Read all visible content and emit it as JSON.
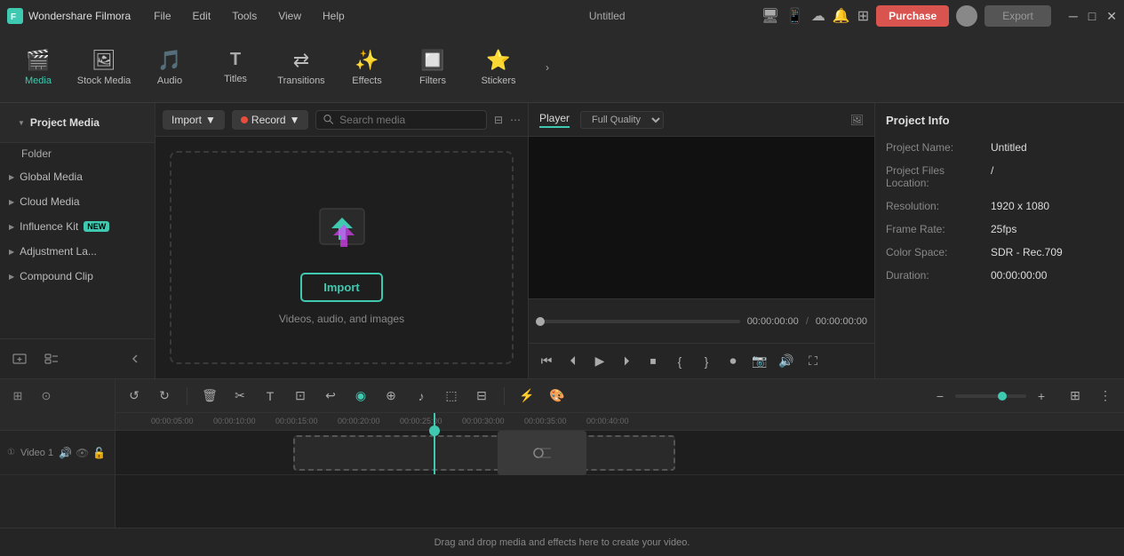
{
  "titlebar": {
    "app_name": "Wondershare Filmora",
    "menu_items": [
      "File",
      "Edit",
      "Tools",
      "View",
      "Help"
    ],
    "project_name": "Untitled",
    "purchase_label": "Purchase",
    "export_label": "Export"
  },
  "toolbar": {
    "items": [
      {
        "id": "media",
        "label": "Media",
        "icon": "🎬"
      },
      {
        "id": "stock_media",
        "label": "Stock Media",
        "icon": "🖼"
      },
      {
        "id": "audio",
        "label": "Audio",
        "icon": "🎵"
      },
      {
        "id": "titles",
        "label": "Titles",
        "icon": "T"
      },
      {
        "id": "transitions",
        "label": "Transitions",
        "icon": "⇄"
      },
      {
        "id": "effects",
        "label": "Effects",
        "icon": "✨"
      },
      {
        "id": "filters",
        "label": "Filters",
        "icon": "🔲"
      },
      {
        "id": "stickers",
        "label": "Stickers",
        "icon": "⭐"
      }
    ],
    "more_label": "›"
  },
  "sidebar": {
    "project_media_label": "Project Media",
    "items": [
      {
        "id": "folder",
        "label": "Folder"
      },
      {
        "id": "global_media",
        "label": "Global Media"
      },
      {
        "id": "cloud_media",
        "label": "Cloud Media"
      },
      {
        "id": "influence_kit",
        "label": "Influence Kit",
        "badge": "NEW"
      },
      {
        "id": "adjustment_la",
        "label": "Adjustment La..."
      },
      {
        "id": "compound_clip",
        "label": "Compound Clip"
      }
    ]
  },
  "media_toolbar": {
    "import_label": "Import",
    "record_label": "Record",
    "search_placeholder": "Search media"
  },
  "drop_zone": {
    "import_label": "Import",
    "sub_text": "Videos, audio, and images"
  },
  "player": {
    "tab_player": "Player",
    "quality_label": "Full Quality",
    "time_current": "00:00:00:00",
    "time_total": "00:00:00:00"
  },
  "project_info": {
    "title": "Project Info",
    "fields": [
      {
        "label": "Project Name:",
        "value": "Untitled"
      },
      {
        "label": "Project Files Location:",
        "value": "/"
      },
      {
        "label": "Resolution:",
        "value": "1920 x 1080"
      },
      {
        "label": "Frame Rate:",
        "value": "25fps"
      },
      {
        "label": "Color Space:",
        "value": "SDR - Rec.709"
      },
      {
        "label": "Duration:",
        "value": "00:00:00:00"
      }
    ]
  },
  "timeline": {
    "ruler_marks": [
      "00:00:05:00",
      "00:00:10:00",
      "00:00:15:00",
      "00:00:20:00",
      "00:00:25:00",
      "00:00:30:00",
      "00:00:35:00",
      "00:00:40:00"
    ],
    "track_label": "Video 1",
    "drop_hint": "Drag and drop media and effects here to create your video."
  }
}
